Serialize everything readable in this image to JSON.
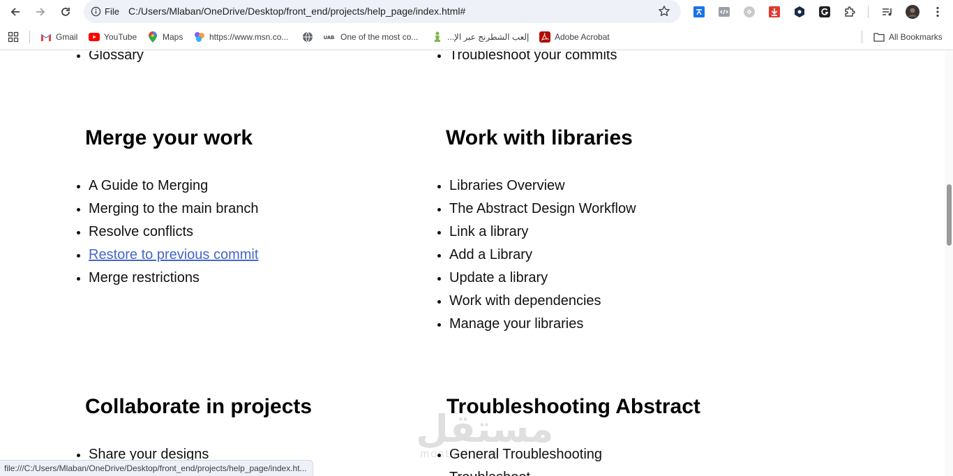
{
  "browser": {
    "site_label": "File",
    "url": "C:/Users/Mlaban/OneDrive/Desktop/front_end/projects/help_page/index.html#",
    "status_url": "file:///C:/Users/Mlaban/OneDrive/Desktop/front_end/projects/help_page/index.ht..."
  },
  "bookmarks": {
    "items": [
      {
        "label": "Gmail",
        "icon": "gmail-icon"
      },
      {
        "label": "YouTube",
        "icon": "youtube-icon"
      },
      {
        "label": "Maps",
        "icon": "maps-icon"
      },
      {
        "label": "https://www.msn.co...",
        "icon": "msn-icon"
      },
      {
        "label": "",
        "icon": "globe-icon"
      },
      {
        "label": "One of the most co...",
        "icon": "uab-icon"
      },
      {
        "label": "إلعب الشطرنج عبر الإ...",
        "icon": "chess-icon"
      },
      {
        "label": "Adobe Acrobat",
        "icon": "acrobat-icon"
      }
    ],
    "all_label": "All Bookmarks"
  },
  "page": {
    "top_left_item": "Glossary",
    "top_right_item": "Troubleshoot your commits",
    "sections": [
      {
        "title": "Merge your work",
        "items": [
          "A Guide to Merging",
          "Merging to the main branch",
          "Resolve conflicts",
          "Restore to previous commit",
          "Merge restrictions"
        ],
        "link_index": 3
      },
      {
        "title": "Work with libraries",
        "items": [
          "Libraries Overview",
          "The Abstract Design Workflow",
          "Link a library",
          "Add a Library",
          "Update a library",
          "Work with dependencies",
          "Manage your libraries"
        ]
      },
      {
        "title": "Collaborate in projects",
        "items": [
          "Share your designs"
        ]
      },
      {
        "title": "Troubleshooting Abstract",
        "items": [
          "General Troubleshooting",
          "Troubleshoot..."
        ]
      }
    ],
    "link_color": "#4466c8"
  },
  "watermark": {
    "main": "مستقل",
    "sub": "mostaql.com"
  }
}
